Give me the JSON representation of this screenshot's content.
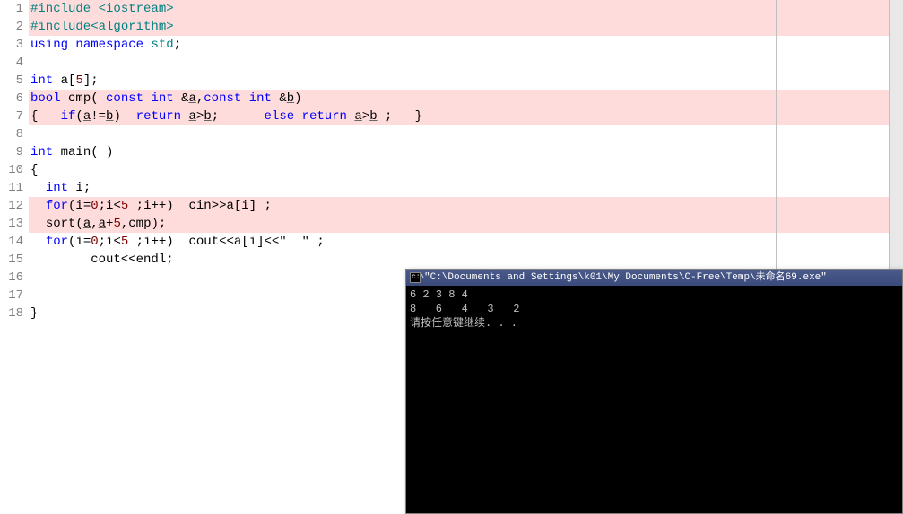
{
  "gutter": [
    "1",
    "2",
    "3",
    "4",
    "5",
    "6",
    "7",
    "8",
    "9",
    "10",
    "11",
    "12",
    "13",
    "14",
    "15",
    "16",
    "17",
    "18"
  ],
  "code": {
    "l1_include": "#include",
    "l1_hdr": "<iostream>",
    "l2_include": "#include",
    "l2_hdr": "<algorithm>",
    "l3_using": "using",
    "l3_namespace": "namespace",
    "l3_std": "std",
    "l3_semi": ";",
    "l5_int": "int",
    "l5_a": " a[",
    "l5_5": "5",
    "l5_close": "];",
    "l6_bool": "bool",
    "l6_cmp": " cmp( ",
    "l6_const1": "const",
    "l6_int1": " int",
    "l6_amp1": " &",
    "l6_a1": "a",
    "l6_comma": ",",
    "l6_const2": "const",
    "l6_int2": " int",
    "l6_amp2": " &",
    "l6_b1": "b",
    "l6_paren": ")",
    "l7_open": "{   ",
    "l7_if": "if",
    "l7_cond1": "(",
    "l7_a": "a",
    "l7_neq": "!=",
    "l7_b": "b",
    "l7_cond2": ")  ",
    "l7_return1": "return",
    "l7_sp1": " ",
    "l7_a2": "a",
    "l7_gt": ">",
    "l7_b2": "b",
    "l7_semi1": ";      ",
    "l7_else": "else",
    "l7_sp2": " ",
    "l7_return2": "return",
    "l7_sp3": " ",
    "l7_a3": "a",
    "l7_gt2": ">",
    "l7_b3": "b",
    "l7_tail": " ;   }",
    "l9_int": "int",
    "l9_main": " main( )",
    "l10": "{",
    "l11_pad": "  ",
    "l11_int": "int",
    "l11_i": " i;",
    "l12_pad": "  ",
    "l12_for": "for",
    "l12_p1": "(i=",
    "l12_0": "0",
    "l12_semi": ";i<",
    "l12_5": "5",
    "l12_p2": " ;i++)  cin>>a[i] ;",
    "l13_pad": "  ",
    "l13_sort": "sort(",
    "l13_a": "a",
    "l13_c": ",",
    "l13_a2": "a",
    "l13_plus": "+",
    "l13_5": "5",
    "l13_tail": ",cmp);",
    "l14_pad": "  ",
    "l14_for": "for",
    "l14_p1": "(i=",
    "l14_0": "0",
    "l14_semi": ";i<",
    "l14_5": "5",
    "l14_p2": " ;i++)  cout<<a[i]<<\"  \" ;",
    "l15": "        cout<<endl;",
    "l18": "}"
  },
  "console": {
    "title": "\"C:\\Documents and Settings\\k01\\My Documents\\C-Free\\Temp\\未命名69.exe\"",
    "icon": "c:\\",
    "line1": "6 2 3 8 4",
    "line2": "8   6   4   3   2",
    "line3": "请按任意键继续. . ."
  }
}
